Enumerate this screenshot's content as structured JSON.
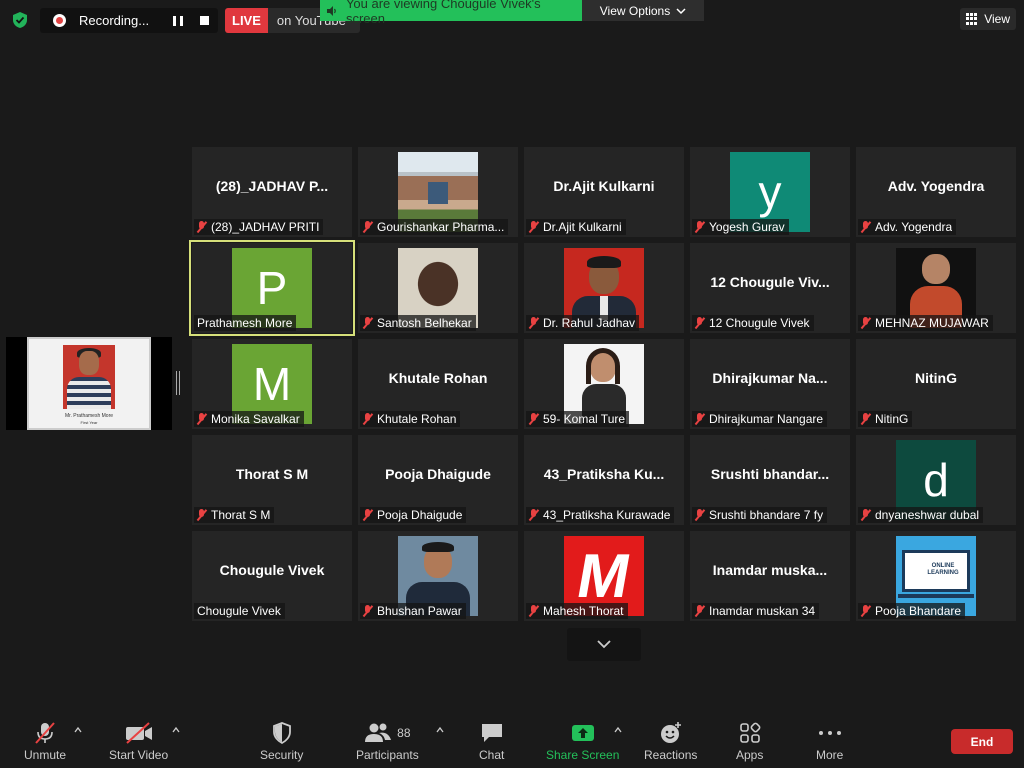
{
  "topbar": {
    "recording_label": "Recording...",
    "live_badge": "LIVE",
    "live_destination": "on YouTube",
    "viewing_banner": "You are viewing Chougule Vivek's screen",
    "view_options": "View Options",
    "view_label": "View"
  },
  "self_view": {
    "caption_line1": "Mr. Prathamesh More",
    "caption_line2": "First Year"
  },
  "tiles": [
    {
      "big": "(28)_JADHAV P...",
      "label": "(28)_JADHAV PRITI"
    },
    {
      "big": "",
      "label": "Gourishankar Pharma..."
    },
    {
      "big": "Dr.Ajit Kulkarni",
      "label": "Dr.Ajit Kulkarni"
    },
    {
      "big": "",
      "label": "Yogesh Gurav",
      "avatar": "y"
    },
    {
      "big": "Adv. Yogendra",
      "label": "Adv. Yogendra"
    },
    {
      "big": "",
      "label": "Prathamesh More",
      "avatar": "P"
    },
    {
      "big": "",
      "label": "Santosh Belhekar"
    },
    {
      "big": "",
      "label": "Dr. Rahul Jadhav"
    },
    {
      "big": "12 Chougule Viv...",
      "label": "12 Chougule Vivek"
    },
    {
      "big": "",
      "label": "MEHNAZ MUJAWAR"
    },
    {
      "big": "",
      "label": "Monika Savalkar",
      "avatar": "M"
    },
    {
      "big": "Khutale Rohan",
      "label": "Khutale Rohan"
    },
    {
      "big": "",
      "label": "59- Komal Ture"
    },
    {
      "big": "Dhirajkumar  Na...",
      "label": "Dhirajkumar Nangare"
    },
    {
      "big": "NitinG",
      "label": "NitinG"
    },
    {
      "big": "Thorat S M",
      "label": "Thorat S M"
    },
    {
      "big": "Pooja Dhaigude",
      "label": "Pooja Dhaigude"
    },
    {
      "big": "43_Pratiksha  Ku...",
      "label": "43_Pratiksha Kurawade"
    },
    {
      "big": "Srushti  bhandar...",
      "label": "Srushti bhandare 7 fy"
    },
    {
      "big": "",
      "label": "dnyaneshwar dubal",
      "avatar": "d"
    },
    {
      "big": "Chougule Vivek",
      "label": "Chougule Vivek"
    },
    {
      "big": "",
      "label": "Bhushan Pawar"
    },
    {
      "big": "",
      "label": "Mahesh Thorat",
      "logo_letter": "M"
    },
    {
      "big": "Inamdar  muska...",
      "label": "Inamdar muskan 34"
    },
    {
      "big": "",
      "label": "Pooja Bhandare",
      "logo_text": "ONLINE LEARNING"
    }
  ],
  "toolbar": {
    "unmute": "Unmute",
    "start_video": "Start Video",
    "security": "Security",
    "participants": "Participants",
    "participants_count": "88",
    "chat": "Chat",
    "share_screen": "Share Screen",
    "reactions": "Reactions",
    "apps": "Apps",
    "more": "More",
    "end": "End"
  },
  "colors": {
    "live_red": "#e0383e",
    "banner_green": "#23c05a",
    "share_green": "#23c05a",
    "end_red": "#c82b2b",
    "active_speaker": "#d6e07a",
    "avatar_teal": "#0f8a76",
    "avatar_green": "#6aa534",
    "avatar_darkteal": "#0d4a3e"
  }
}
